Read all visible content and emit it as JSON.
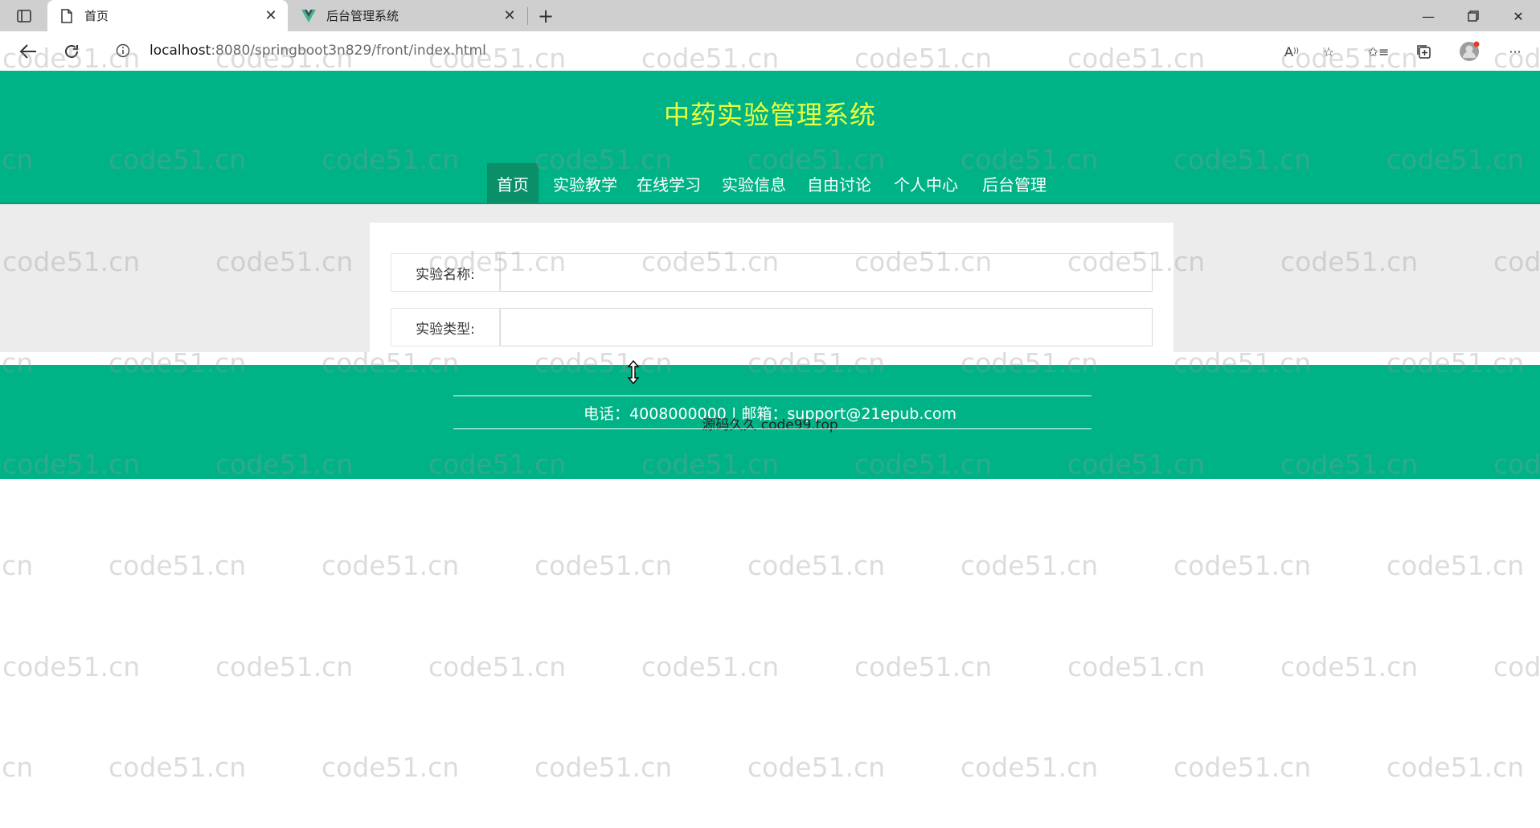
{
  "browser": {
    "tabs": [
      {
        "title": "首页",
        "icon": "document-icon",
        "active": true
      },
      {
        "title": "后台管理系统",
        "icon": "vue-logo-icon",
        "active": false
      }
    ],
    "url_host": "localhost",
    "url_rest": ":8080/springboot3n829/front/index.html"
  },
  "site": {
    "title": "中药实验管理系统",
    "nav": [
      "首页",
      "实验教学",
      "在线学习",
      "实验信息",
      "自由讨论",
      "个人中心",
      "后台管理"
    ],
    "active_nav": 0
  },
  "form": {
    "fields": [
      {
        "label": "实验名称:",
        "value": ""
      },
      {
        "label": "实验类型:",
        "value": ""
      }
    ]
  },
  "footer": {
    "contact": "电话：4008000000 | 邮箱：support@21epub.com",
    "overlay": "源码久久 code99.top"
  },
  "watermark": {
    "text": "code51.cn"
  },
  "colors": {
    "primary": "#00b386",
    "title": "#e8ff3c",
    "active_nav": "#0b8f68"
  }
}
